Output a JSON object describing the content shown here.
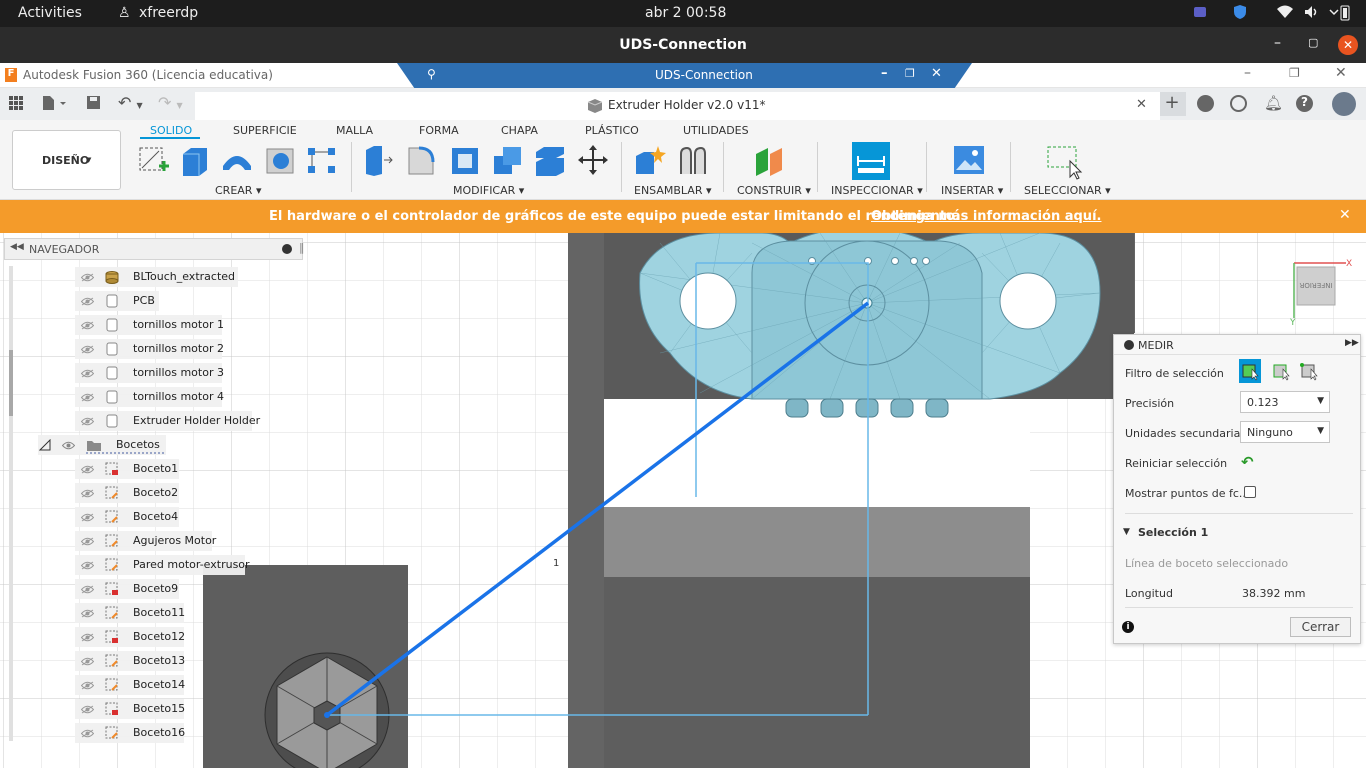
{
  "system_bar": {
    "activities": "Activities",
    "app": "xfreerdp",
    "clock": "abr 2  00:58"
  },
  "remote_window": {
    "title": "UDS-Connection"
  },
  "fusion_titlebar": {
    "title": "Autodesk Fusion 360 (Licencia educativa)",
    "rdp_tab": "UDS-Connection"
  },
  "document": {
    "tab_title": "Extruder Holder v2.0 v11*"
  },
  "ribbon": {
    "workspace": "DISEÑO",
    "tabs": [
      "SOLIDO",
      "SUPERFICIE",
      "MALLA",
      "FORMA",
      "CHAPA",
      "PLÁSTICO",
      "UTILIDADES"
    ],
    "active_tab": "SOLIDO",
    "groups": {
      "crear": "CREAR",
      "modificar": "MODIFICAR",
      "ensamblar": "ENSAMBLAR",
      "construir": "CONSTRUIR",
      "inspeccionar": "INSPECCIONAR",
      "insertar": "INSERTAR",
      "seleccionar": "SELECCIONAR"
    }
  },
  "warning": {
    "text": "El hardware o el controlador de gráficos de este equipo puede estar limitando el rendimiento.",
    "link": "Obtenga más información aquí."
  },
  "navigator": {
    "title": "NAVEGADOR",
    "items": [
      {
        "label": "BLTouch_extracted",
        "icon": "component-icon"
      },
      {
        "label": "PCB",
        "icon": "body-icon"
      },
      {
        "label": "tornillos motor 1",
        "icon": "body-icon"
      },
      {
        "label": "tornillos motor 2",
        "icon": "body-icon"
      },
      {
        "label": "tornillos motor 3",
        "icon": "body-icon"
      },
      {
        "label": "tornillos motor 4",
        "icon": "body-icon"
      },
      {
        "label": "Extruder Holder Holder",
        "icon": "body-icon"
      }
    ],
    "folder": "Bocetos",
    "sketches": [
      {
        "label": "Boceto1",
        "icon": "sketch-red-icon"
      },
      {
        "label": "Boceto2",
        "icon": "sketch-icon"
      },
      {
        "label": "Boceto4",
        "icon": "sketch-icon"
      },
      {
        "label": "Agujeros Motor",
        "icon": "sketch-icon"
      },
      {
        "label": "Pared motor-extrusor",
        "icon": "sketch-icon"
      },
      {
        "label": "Boceto9",
        "icon": "sketch-red-icon"
      },
      {
        "label": "Boceto11",
        "icon": "sketch-icon"
      },
      {
        "label": "Boceto12",
        "icon": "sketch-red-icon"
      },
      {
        "label": "Boceto13",
        "icon": "sketch-icon"
      },
      {
        "label": "Boceto14",
        "icon": "sketch-icon"
      },
      {
        "label": "Boceto15",
        "icon": "sketch-red-icon"
      },
      {
        "label": "Boceto16",
        "icon": "sketch-icon"
      }
    ]
  },
  "viewport": {
    "dimension_label": "1",
    "viewcube_label": "INFERIOR",
    "axis_x": "X",
    "axis_y": "Y"
  },
  "measure_panel": {
    "title": "MEDIR",
    "filter_label": "Filtro de selección",
    "precision_label": "Precisión",
    "precision_value": "0.123",
    "units_label": "Unidades secundarias",
    "units_value": "Ninguno",
    "reset_label": "Reiniciar selección",
    "show_points_label": "Mostrar puntos de fc...",
    "selection_header": "Selección 1",
    "selection_type": "Línea de boceto seleccionado",
    "length_label": "Longitud",
    "length_value": "38.392 mm",
    "close_label": "Cerrar"
  },
  "colors": {
    "accent": "#0696d7",
    "warning": "#f49b2a",
    "selection_line": "#1a73e8",
    "model_blue": "#9fd3e0"
  }
}
